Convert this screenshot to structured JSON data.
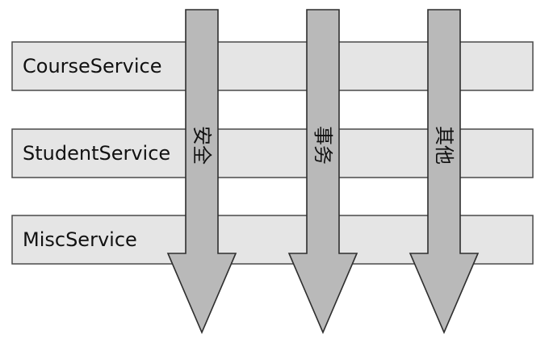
{
  "services": [
    {
      "label": "CourseService"
    },
    {
      "label": "StudentService"
    },
    {
      "label": "MiscService"
    }
  ],
  "aspects": [
    {
      "label": "安全"
    },
    {
      "label": "事务"
    },
    {
      "label": "其他"
    }
  ],
  "colors": {
    "bar_fill": "#e5e5e5",
    "bar_stroke": "#4a4a4a",
    "arrow_fill": "#b9b9b9",
    "arrow_stroke": "#2e2e2e",
    "text": "#111111"
  }
}
